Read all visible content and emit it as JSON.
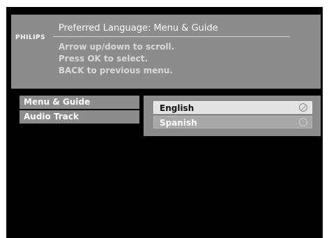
{
  "header": {
    "brand": "PHILIPS",
    "title": "Preferred Language: Menu & Guide",
    "instructions": [
      "Arrow up/down to scroll.",
      "Press OK to select.",
      "BACK to previous menu."
    ]
  },
  "menu": {
    "items": [
      {
        "label": "Menu & Guide"
      },
      {
        "label": "Audio Track"
      }
    ]
  },
  "options": {
    "items": [
      {
        "label": "English",
        "selected": true,
        "icon": "checked-radio-icon"
      },
      {
        "label": "Spanish",
        "selected": false,
        "icon": "empty-radio-icon"
      }
    ]
  },
  "colors": {
    "background": "#000000",
    "panel": "#8c8c8c",
    "selected_row": "#e4e4e4",
    "unselected_row": "#a8a8a8"
  }
}
